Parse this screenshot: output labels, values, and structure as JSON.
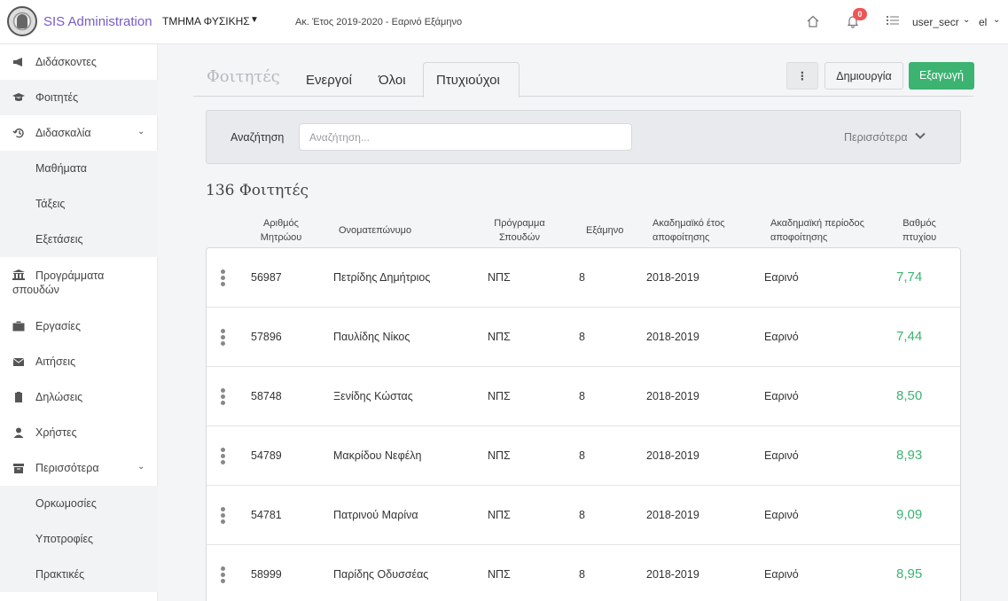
{
  "header": {
    "brand": "SIS Administration",
    "department": "ΤΜΗΜΑ ΦΥΣΙΚΗΣ",
    "academic_year": "Ακ. Έτος 2019-2020 - Εαρινό Εξάμηνο",
    "notifications_count": "0",
    "user": "user_secr",
    "language": "el"
  },
  "sidebar": {
    "items": [
      {
        "label": "Διδάσκοντες",
        "icon": "bullhorn-icon"
      },
      {
        "label": "Φοιτητές",
        "icon": "graduation-cap-icon"
      },
      {
        "label": "Διδασκαλία",
        "icon": "history-icon"
      },
      {
        "label": "Μαθήματα"
      },
      {
        "label": "Τάξεις"
      },
      {
        "label": "Εξετάσεις"
      },
      {
        "label": "Προγράμματα",
        "label2": "σπουδών",
        "icon": "institution-icon"
      },
      {
        "label": "Εργασίες",
        "icon": "briefcase-icon"
      },
      {
        "label": "Αιτήσεις",
        "icon": "envelope-icon"
      },
      {
        "label": "Δηλώσεις",
        "icon": "clipboard-icon"
      },
      {
        "label": "Χρήστες",
        "icon": "user-icon"
      },
      {
        "label": "Περισσότερα",
        "icon": "archive-icon"
      },
      {
        "label": "Ορκωμοσίες"
      },
      {
        "label": "Υποτροφίες"
      },
      {
        "label": "Πρακτικές"
      }
    ]
  },
  "main": {
    "title": "Φοιτητές",
    "tabs": [
      "Ενεργοί",
      "Όλοι",
      "Πτυχιούχοι"
    ],
    "buttons": {
      "kebab": "⋮",
      "create": "Δημιουργία",
      "export": "Εξαγωγή"
    },
    "search": {
      "label": "Αναζήτηση",
      "placeholder": "Αναζήτηση...",
      "value": "",
      "more": "Περισσότερα"
    },
    "count": "136 Φοιτητές",
    "columns": [
      {
        "l1": "Αριθμός",
        "l2": "Μητρώου"
      },
      {
        "l1": "Ονοματεπώνυμο",
        "l2": ""
      },
      {
        "l1": "Πρόγραμμα",
        "l2": "Σπουδών"
      },
      {
        "l1": "Εξάμηνο",
        "l2": ""
      },
      {
        "l1": "Ακαδημαϊκό έτος",
        "l2": "αποφοίτησης"
      },
      {
        "l1": "Ακαδημαϊκή περίοδος",
        "l2": "αποφοίτησης"
      },
      {
        "l1": "Βαθμός",
        "l2": "πτυχίου"
      }
    ],
    "rows": [
      {
        "id": "56987",
        "name": "Πετρίδης Δημήτριος",
        "program": "ΝΠΣ",
        "semester": "8",
        "year": "2018-2019",
        "period": "Εαρινό",
        "grade": "7,74"
      },
      {
        "id": "57896",
        "name": "Παυλίδης Νίκος",
        "program": "ΝΠΣ",
        "semester": "8",
        "year": "2018-2019",
        "period": "Εαρινό",
        "grade": "7,44"
      },
      {
        "id": "58748",
        "name": "Ξενίδης Κώστας",
        "program": "ΝΠΣ",
        "semester": "8",
        "year": "2018-2019",
        "period": "Εαρινό",
        "grade": "8,50"
      },
      {
        "id": "54789",
        "name": "Μακρίδου Νεφέλη",
        "program": "ΝΠΣ",
        "semester": "8",
        "year": "2018-2019",
        "period": "Εαρινό",
        "grade": "8,93"
      },
      {
        "id": "54781",
        "name": "Πατρινού Μαρίνα",
        "program": "ΝΠΣ",
        "semester": "8",
        "year": "2018-2019",
        "period": "Εαρινό",
        "grade": "9,09"
      },
      {
        "id": "58999",
        "name": "Παρίδης Οδυσσέας",
        "program": "ΝΠΣ",
        "semester": "8",
        "year": "2018-2019",
        "period": "Εαρινό",
        "grade": "8,95"
      }
    ]
  },
  "colors": {
    "brand": "#7a5cc6",
    "accent": "#3cb371",
    "badge": "#f05454"
  }
}
